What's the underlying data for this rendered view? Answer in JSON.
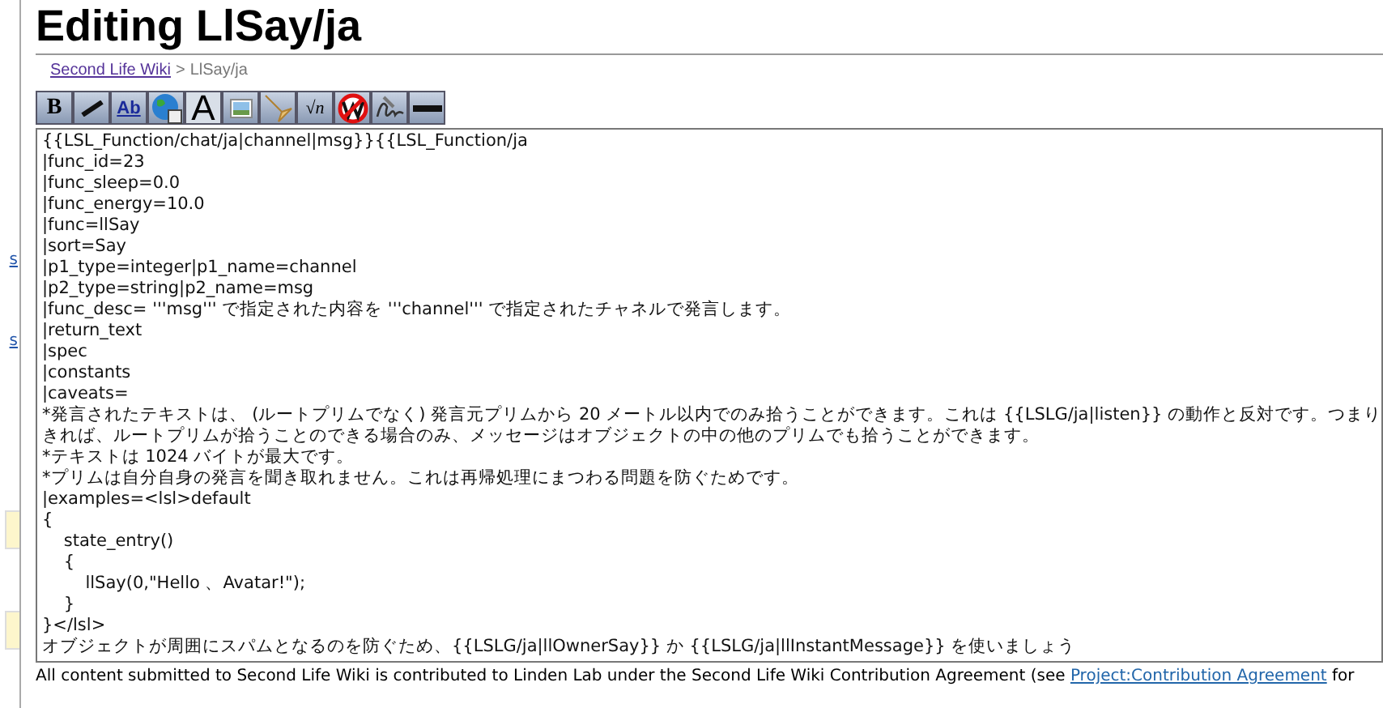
{
  "sidebar": {
    "links": [
      "s",
      "s"
    ]
  },
  "title": "Editing LlSay/ja",
  "breadcrumb": {
    "link": "Second Life Wiki",
    "separator": ">",
    "current": "LlSay/ja"
  },
  "toolbar": [
    {
      "kind": "bold",
      "label": "B"
    },
    {
      "kind": "italic"
    },
    {
      "kind": "link",
      "label": "Ab"
    },
    {
      "kind": "globe"
    },
    {
      "kind": "headline",
      "label": "A"
    },
    {
      "kind": "image"
    },
    {
      "kind": "media"
    },
    {
      "kind": "math",
      "label": "√n"
    },
    {
      "kind": "nowiki"
    },
    {
      "kind": "signature"
    },
    {
      "kind": "rule"
    }
  ],
  "editor": {
    "lines": [
      "{{LSL_Function/chat/ja|channel|msg}}{{LSL_Function/ja",
      "|func_id=23",
      "|func_sleep=0.0",
      "|func_energy=10.0",
      "|func=llSay",
      "|sort=Say",
      "|p1_type=integer|p1_name=channel",
      "|p2_type=string|p2_name=msg",
      "|func_desc= '''msg''' で指定された内容を '''channel''' で指定されたチャネルで発言します。",
      "|return_text",
      "|spec",
      "|constants",
      "|caveats=",
      "*発言されたテキストは、 (ルートプリムでなく) 発言元プリムから 20 メートル以内でのみ拾うことができます。これは {{LSLG/ja|listen}} の動作と反対です。つまり",
      "きれば、ルートプリムが拾うことのできる場合のみ、メッセージはオブジェクトの中の他のプリムでも拾うことができます。",
      "*テキストは 1024 バイトが最大です。",
      "*プリムは自分自身の発言を聞き取れません。これは再帰処理にまつわる問題を防ぐためです。",
      "|examples=<lsl>default",
      "{",
      "    state_entry()",
      "    {",
      "        llSay(0,\"Hello 、Avatar!\");",
      "    }",
      "}</lsl>",
      "オブジェクトが周囲にスパムとなるのを防ぐため、{{LSLG/ja|llOwnerSay}} か {{LSLG/ja|llInstantMessage}} を使いましょう"
    ]
  },
  "footer": {
    "text": "All content submitted to Second Life Wiki is contributed to Linden Lab under the Second Life Wiki Contribution Agreement (see",
    "link": "Project:Contribution Agreement",
    "after": "for"
  }
}
